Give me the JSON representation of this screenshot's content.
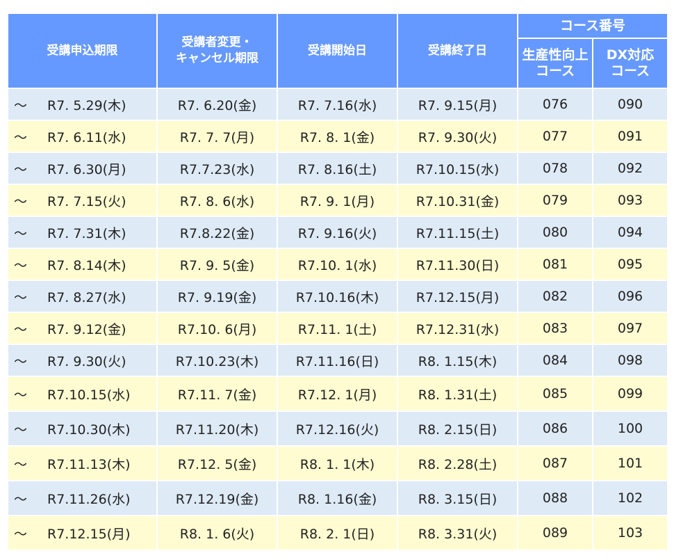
{
  "header": {
    "col1": "受講申込期限",
    "col2_line1": "受講者変更・",
    "col2_line2": "キャンセル期限",
    "col3": "受講開始日",
    "col4": "受講終了日",
    "group": "コース番号",
    "sub1_line1": "生産性向上",
    "sub1_line2": "コース",
    "sub2_line1": "DX対応",
    "sub2_line2": "コース"
  },
  "rows": [
    {
      "prefix": "～",
      "deadline": "R7. 5.29(木)",
      "cancel": "R7. 6.20(金)",
      "start": "R7. 7.16(水)",
      "end": "R7. 9.15(月)",
      "prod": "076",
      "dx": "090"
    },
    {
      "prefix": "～",
      "deadline": "R7. 6.11(水)",
      "cancel": "R7. 7. 7(月)",
      "start": "R7. 8. 1(金)",
      "end": "R7. 9.30(火)",
      "prod": "077",
      "dx": "091"
    },
    {
      "prefix": "～",
      "deadline": "R7. 6.30(月)",
      "cancel": "R7.7.23(水)",
      "start": "R7. 8.16(土)",
      "end": "R7.10.15(水)",
      "prod": "078",
      "dx": "092"
    },
    {
      "prefix": "～",
      "deadline": "R7. 7.15(火)",
      "cancel": "R7. 8. 6(水)",
      "start": "R7. 9. 1(月)",
      "end": "R7.10.31(金)",
      "prod": "079",
      "dx": "093"
    },
    {
      "prefix": "～",
      "deadline": "R7. 7.31(木)",
      "cancel": "R7.8.22(金)",
      "start": "R7. 9.16(火)",
      "end": "R7.11.15(土)",
      "prod": "080",
      "dx": "094"
    },
    {
      "prefix": "～",
      "deadline": "R7. 8.14(木)",
      "cancel": "R7. 9. 5(金)",
      "start": "R7.10. 1(水)",
      "end": "R7.11.30(日)",
      "prod": "081",
      "dx": "095"
    },
    {
      "prefix": "～",
      "deadline": "R7. 8.27(水)",
      "cancel": "R7. 9.19(金)",
      "start": "R7.10.16(木)",
      "end": "R7.12.15(月)",
      "prod": "082",
      "dx": "096"
    },
    {
      "prefix": "～",
      "deadline": "R7. 9.12(金)",
      "cancel": "R7.10. 6(月)",
      "start": "R7.11. 1(土)",
      "end": "R7.12.31(水)",
      "prod": "083",
      "dx": "097"
    },
    {
      "prefix": "～",
      "deadline": "R7. 9.30(火)",
      "cancel": "R7.10.23(木)",
      "start": "R7.11.16(日)",
      "end": "R8. 1.15(木)",
      "prod": "084",
      "dx": "098"
    },
    {
      "prefix": "～",
      "deadline": "R7.10.15(水)",
      "cancel": "R7.11. 7(金)",
      "start": "R7.12. 1(月)",
      "end": "R8. 1.31(土)",
      "prod": "085",
      "dx": "099"
    },
    {
      "prefix": "～",
      "deadline": "R7.10.30(木)",
      "cancel": "R7.11.20(木)",
      "start": "R7.12.16(火)",
      "end": "R8. 2.15(日)",
      "prod": "086",
      "dx": "100"
    },
    {
      "prefix": "～",
      "deadline": "R7.11.13(木)",
      "cancel": "R7.12. 5(金)",
      "start": "R8. 1. 1(木)",
      "end": "R8. 2.28(土)",
      "prod": "087",
      "dx": "101"
    },
    {
      "prefix": "～",
      "deadline": "R7.11.26(水)",
      "cancel": "R7.12.19(金)",
      "start": "R8. 1.16(金)",
      "end": "R8. 3.15(日)",
      "prod": "088",
      "dx": "102"
    },
    {
      "prefix": "～",
      "deadline": "R7.12.15(月)",
      "cancel": "R8. 1. 6(火)",
      "start": "R8. 2. 1(日)",
      "end": "R8. 3.31(火)",
      "prod": "089",
      "dx": "103"
    }
  ]
}
